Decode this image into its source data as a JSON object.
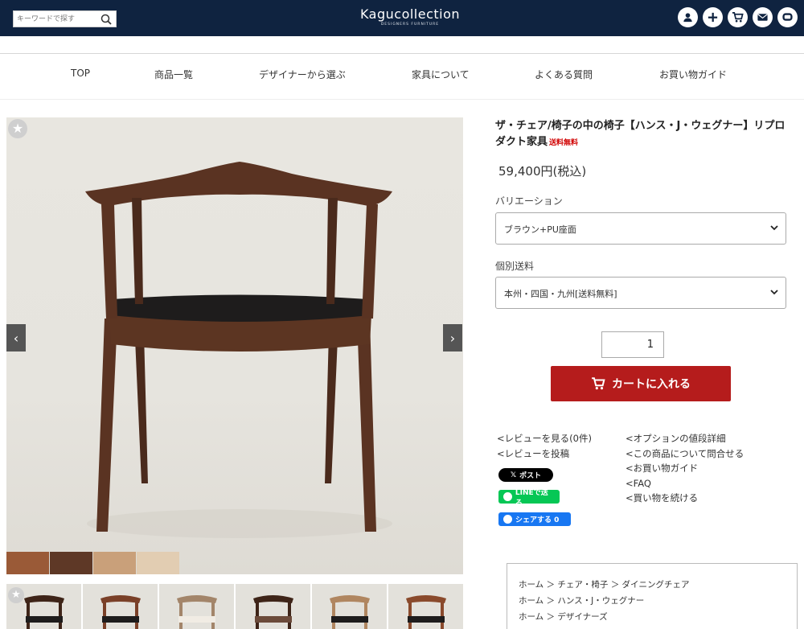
{
  "header": {
    "search_placeholder": "キーワードで探す",
    "logo_text": "Kagucollection",
    "logo_sub": "DESIGNERS FURNITURE",
    "icons": [
      "user-icon",
      "plus-icon",
      "cart-icon",
      "mail-icon",
      "chat-icon"
    ]
  },
  "nav": {
    "items": [
      "TOP",
      "商品一覧",
      "デザイナーから選ぶ",
      "家具について",
      "よくある質問",
      "お買い物ガイド"
    ]
  },
  "product": {
    "title": "ザ・チェア/椅子の中の椅子【ハンス・J・ウェグナー】リプロダクト家具",
    "free_shipping": "送料無料",
    "price": "59,400円(税込)",
    "variation_label": "バリエーション",
    "variation_value": "ブラウン+PU座面",
    "shipping_label": "個別送料",
    "shipping_value": "本州・四国・九州[送料無料]",
    "quantity": "1",
    "cart_button": "カートに入れる"
  },
  "links_left": [
    "<レビューを見る(0件)",
    "<レビューを投稿"
  ],
  "links_right": [
    "<オプションの値段詳細",
    "<この商品について問合せる",
    "<お買い物ガイド",
    "<FAQ",
    "<買い物を続ける"
  ],
  "social": {
    "x": "ポスト",
    "line": "LINEで送る",
    "facebook": "シェアする 0"
  },
  "breadcrumbs": [
    "ホーム ＞ チェア・椅子 ＞ ダイニングチェア",
    "ホーム ＞ ハンス・J・ウェグナー",
    "ホーム ＞ デザイナーズ"
  ],
  "gallery": {
    "prev_label": "‹",
    "next_label": "›",
    "star": "★",
    "swatch_colors": [
      "#9a5a37",
      "#5e3826",
      "#c9a07a",
      "#e2cdb2"
    ]
  },
  "colors": {
    "header_bg": "#0f2340",
    "cart_button": "#b51c1c",
    "free_ship": "#d00000"
  }
}
